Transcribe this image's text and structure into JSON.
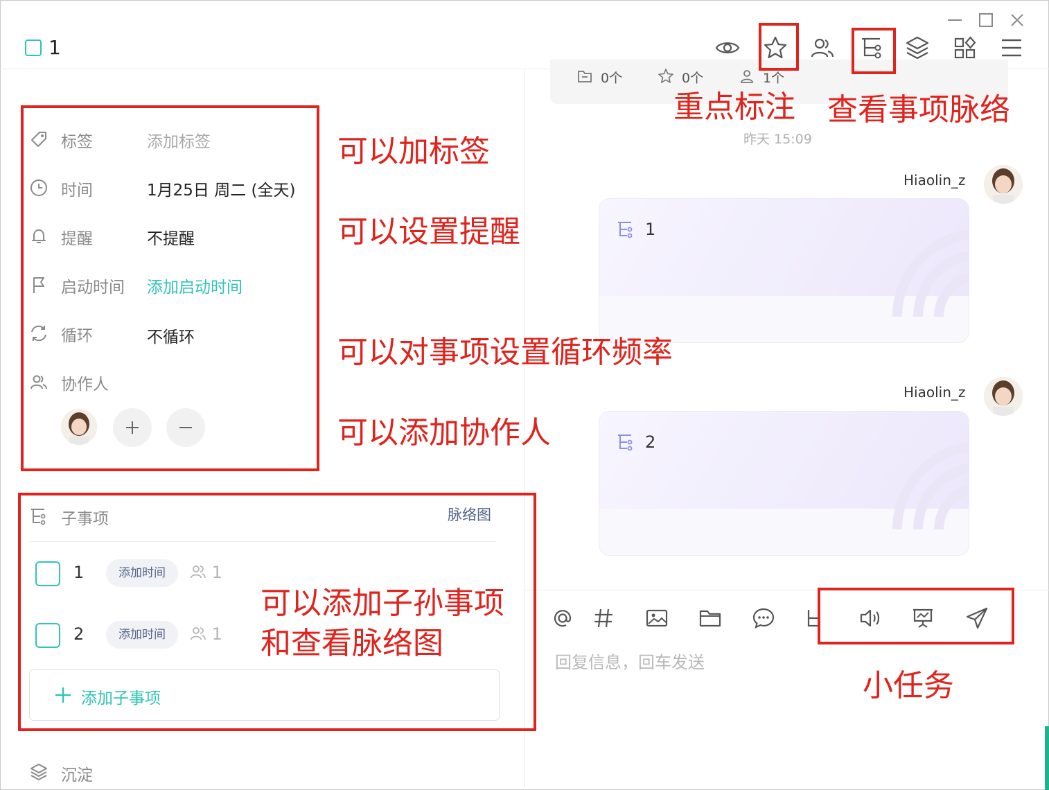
{
  "task": {
    "title": "1"
  },
  "properties": {
    "tag": {
      "label": "标签",
      "value": "添加标签"
    },
    "time": {
      "label": "时间",
      "value": "1月25日 周二 (全天)"
    },
    "reminder": {
      "label": "提醒",
      "value": "不提醒"
    },
    "start_time": {
      "label": "启动时间",
      "value": "添加启动时间"
    },
    "repeat": {
      "label": "循环",
      "value": "不循环"
    },
    "collaborators": {
      "label": "协作人"
    }
  },
  "subtasks": {
    "title": "子事项",
    "map_link": "脉络图",
    "items": [
      {
        "num": "1",
        "time_chip": "添加时间",
        "people": "1"
      },
      {
        "num": "2",
        "time_chip": "添加时间",
        "people": "1"
      }
    ],
    "add_label": "添加子事项"
  },
  "sediment": {
    "label": "沉淀"
  },
  "chat": {
    "meta": {
      "files": "0个",
      "stars": "0个",
      "people": "1个"
    },
    "timestamp": "昨天 15:09",
    "messages": [
      {
        "user": "Hiaolin_z",
        "card_text": "1"
      },
      {
        "user": "Hiaolin_z",
        "card_text": "2"
      }
    ],
    "reply_placeholder": "回复信息，回车发送"
  },
  "annotations": {
    "highlight": "重点标注",
    "context": "查看事项脉络",
    "tags": "可以加标签",
    "reminder": "可以设置提醒",
    "repeat": "可以对事项设置循环频率",
    "collab": "可以添加协作人",
    "subtasks_line1": "可以添加子孙事项",
    "subtasks_line2": "和查看脉络图",
    "mini_task": "小任务"
  },
  "colors": {
    "accent": "#2fc4b6",
    "annotation_red": "#e0231c",
    "chip_text": "#56658a"
  },
  "icons": [
    "eye-icon",
    "star-icon",
    "group-icon",
    "tree-icon",
    "layers-icon",
    "apps-icon",
    "menu-icon",
    "tag-icon",
    "clock-icon",
    "bell-icon",
    "flag-icon",
    "repeat-icon",
    "users-icon",
    "at-icon",
    "hash-icon",
    "image-icon",
    "folder-icon",
    "comment-icon",
    "voice-icon",
    "presentation-icon",
    "send-icon"
  ]
}
